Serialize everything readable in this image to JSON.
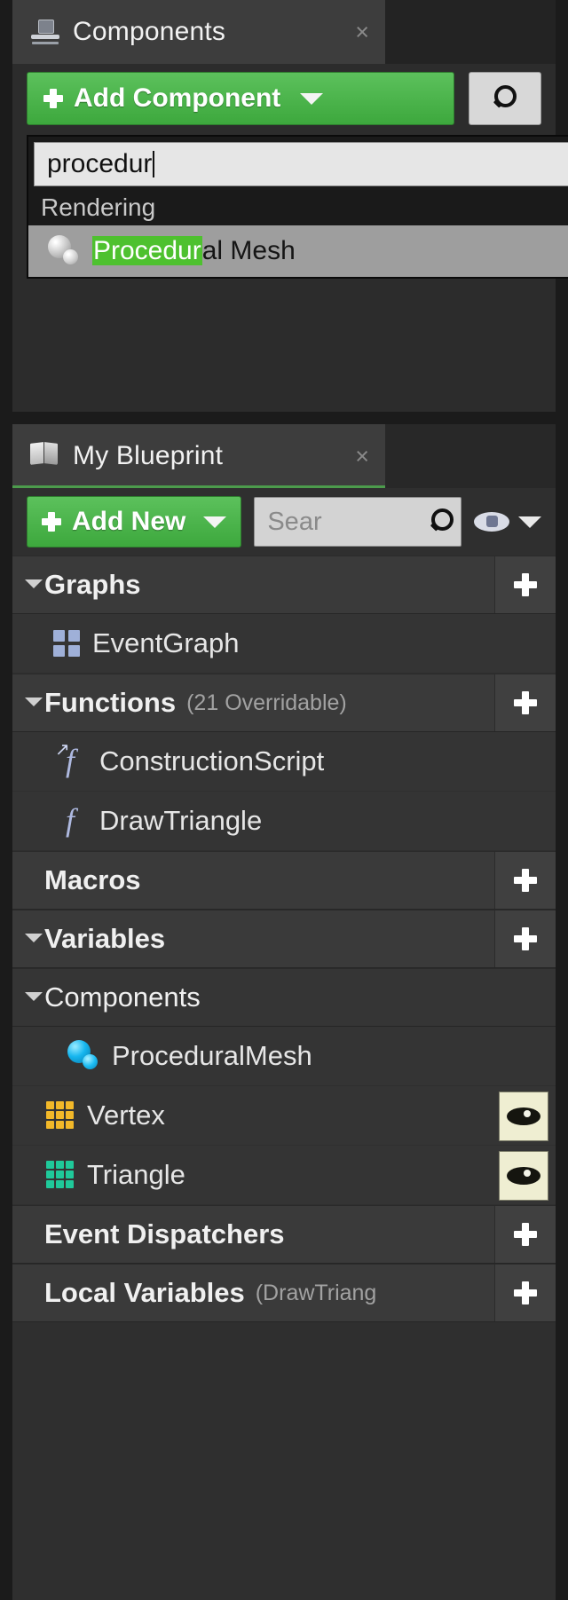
{
  "components_panel": {
    "tab": {
      "title": "Components",
      "icon": "components-icon",
      "close_label": "×"
    },
    "toolbar": {
      "add_component_label": "Add Component",
      "add_component_icon": "plus-icon",
      "dropdown_icon": "chevron-down-icon",
      "search_icon": "search-icon"
    },
    "dropdown": {
      "search_value": "procedur",
      "category": "Rendering",
      "item": {
        "icon": "sphere-mesh-icon",
        "match_text": "Procedur",
        "rest_text": "al Mesh"
      }
    }
  },
  "myblueprint_panel": {
    "tab": {
      "title": "My Blueprint",
      "icon": "book-icon",
      "close_label": "×"
    },
    "toolbar": {
      "add_new_label": "Add New",
      "add_new_icon": "plus-icon",
      "dropdown_icon": "chevron-down-icon",
      "search_placeholder": "Sear",
      "search_icon": "search-icon",
      "eye_icon": "eye-icon",
      "eye_dropdown_icon": "chevron-down-icon"
    },
    "sections": [
      {
        "name": "graphs",
        "label": "Graphs",
        "sub": "",
        "expandable": true,
        "add_label": "+"
      },
      {
        "name": "functions",
        "label": "Functions",
        "sub": "(21 Overridable)",
        "expandable": true,
        "add_label": "+"
      },
      {
        "name": "macros",
        "label": "Macros",
        "sub": "",
        "expandable": false,
        "add_label": "+"
      },
      {
        "name": "variables",
        "label": "Variables",
        "sub": "",
        "expandable": true,
        "add_label": "+"
      },
      {
        "name": "components",
        "label": "Components",
        "sub": "",
        "expandable": true,
        "add_label": ""
      },
      {
        "name": "event-dispatchers",
        "label": "Event Dispatchers",
        "sub": "",
        "expandable": false,
        "add_label": "+"
      },
      {
        "name": "local-variables",
        "label": "Local Variables",
        "sub": "(DrawTriang",
        "expandable": false,
        "add_label": "+"
      }
    ],
    "items": {
      "event_graph": {
        "label": "EventGraph",
        "icon": "event-graph-icon"
      },
      "construction_script": {
        "label": "ConstructionScript",
        "icon": "function-override-icon"
      },
      "draw_triangle": {
        "label": "DrawTriangle",
        "icon": "function-icon"
      },
      "procedural_mesh": {
        "label": "ProceduralMesh",
        "icon": "sphere-mesh-icon"
      },
      "vertex": {
        "label": "Vertex",
        "icon": "array-grid-icon",
        "eye_icon": "eye-icon"
      },
      "triangle": {
        "label": "Triangle",
        "icon": "array-grid-icon",
        "eye_icon": "eye-icon"
      }
    }
  },
  "colors": {
    "accent_green": "#4eb84e",
    "highlight_green": "#4ec12f",
    "panel_bg": "#2f2f2f",
    "tab_bg": "#3d3d3d",
    "vertex_array": "#f2b829",
    "triangle_array": "#1fc99a",
    "mesh_blue": "#16b6ef",
    "function_blue": "#aeb9e0"
  }
}
